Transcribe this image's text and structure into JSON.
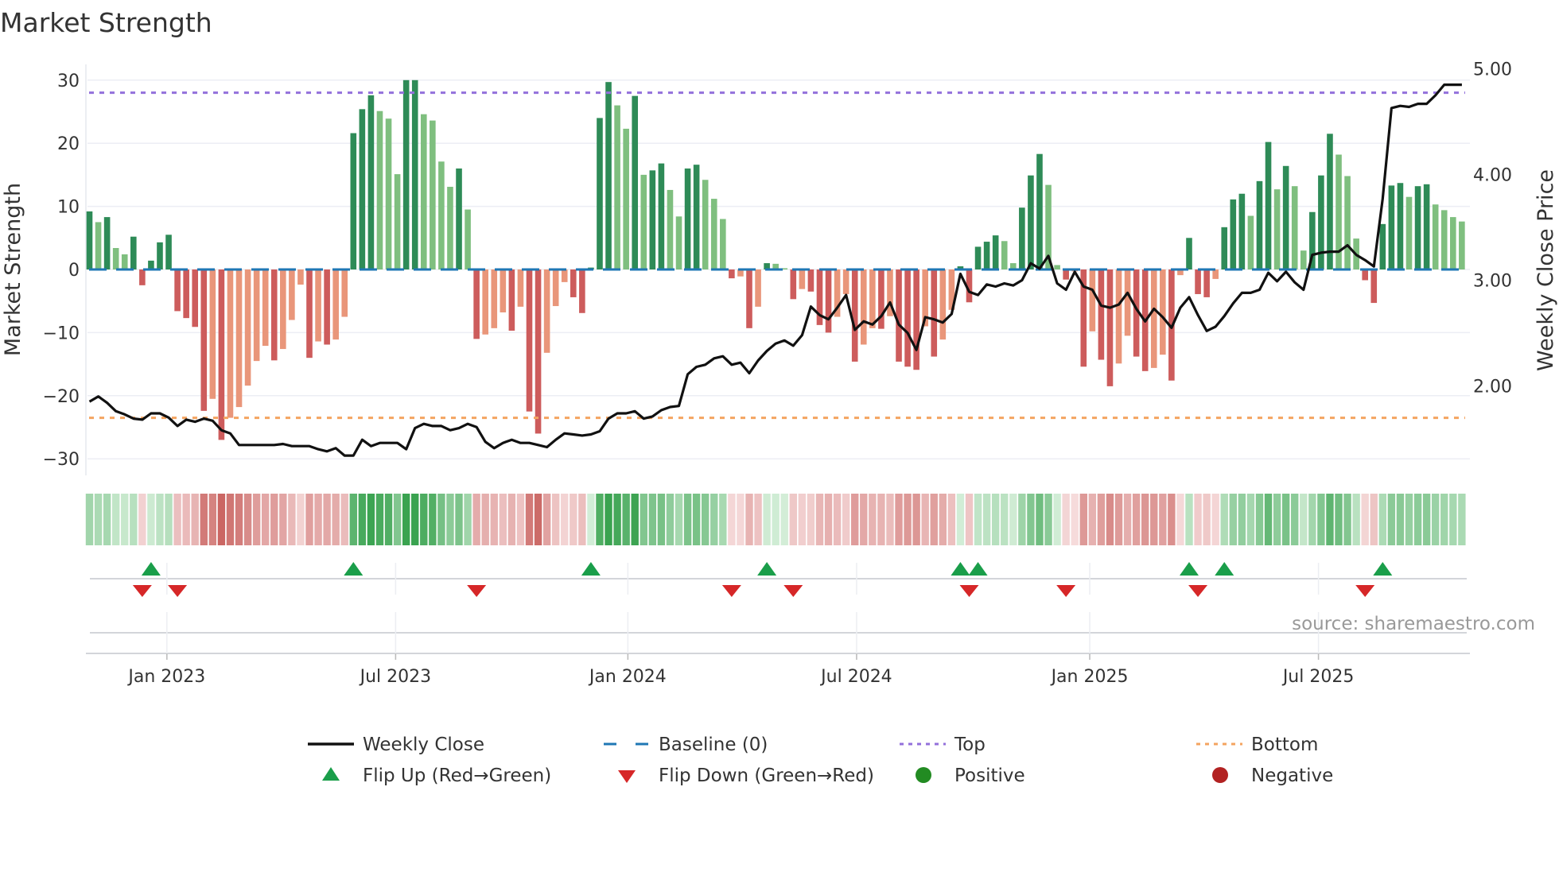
{
  "chart_data": {
    "type": "bar",
    "title": "Market Strength",
    "ylabel": "Market Strength",
    "y2label": "Weekly Close Price",
    "ylim": [
      -32.5,
      32.5
    ],
    "y2lim": [
      1.16,
      5.04
    ],
    "yticks": [
      30,
      20,
      10,
      0,
      -10,
      -20,
      -30
    ],
    "ytick_labels": [
      "30",
      "20",
      "10",
      "0",
      "−10",
      "−20",
      "−30"
    ],
    "y2ticks": [
      5,
      4,
      3,
      2
    ],
    "y2tick_labels": [
      "5.00",
      "4.00",
      "3.00",
      "2.00"
    ],
    "x_unit": "week index",
    "xticks": [
      8.8,
      34.8,
      61.2,
      87.2,
      113.7,
      139.7
    ],
    "xtick_labels": [
      "Jan 2023",
      "Jul 2023",
      "Jan 2024",
      "Jul 2024",
      "Jan 2025",
      "Jul 2025"
    ],
    "top_level": 28,
    "bottom_level": -23.5,
    "baseline": 0,
    "strength": [
      9.2,
      7.5,
      8.3,
      3.4,
      2.4,
      5.2,
      -2.5,
      1.4,
      4.3,
      5.5,
      -6.6,
      -7.7,
      -9.1,
      -22.4,
      -20.5,
      -27,
      -23.5,
      -21.8,
      -18.4,
      -14.5,
      -12.1,
      -14.4,
      -12.6,
      -8,
      -2.4,
      -14,
      -11.4,
      -11.9,
      -11.1,
      -7.5,
      21.6,
      25.4,
      27.6,
      25.1,
      23.9,
      15.1,
      30,
      30,
      24.6,
      23.6,
      17.1,
      13.1,
      16,
      9.5,
      -11,
      -10.3,
      -9.3,
      -6.8,
      -9.7,
      -5.9,
      -22.5,
      -26,
      -13.2,
      -5.8,
      -2,
      -4.4,
      -6.9,
      0.3,
      24,
      29.7,
      26,
      22.3,
      27.5,
      15,
      15.7,
      16.8,
      12.6,
      8.4,
      16,
      16.6,
      14.2,
      11.2,
      8,
      -1.4,
      -1.1,
      -9.3,
      -5.9,
      1,
      0.9,
      0.2,
      -4.7,
      -3.1,
      -3.5,
      -8.8,
      -10,
      -7.5,
      -3.9,
      -14.6,
      -11.9,
      -9.3,
      -9.4,
      -7.4,
      -14.6,
      -15.4,
      -15.9,
      -9,
      -13.8,
      -11.1,
      -6.4,
      0.5,
      -5.2,
      3.6,
      4.4,
      5.4,
      4.5,
      1,
      9.8,
      14.9,
      18.3,
      13.4,
      0.7,
      -1.6,
      -0.3,
      -15.4,
      -9.8,
      -14.3,
      -18.5,
      -14.9,
      -10.5,
      -13.8,
      -16.1,
      -15.6,
      -13.5,
      -17.6,
      -0.9,
      5,
      -3.9,
      -4.4,
      -1.5,
      6.7,
      11.1,
      12,
      8.5,
      14,
      20.2,
      12.7,
      16.4,
      13.2,
      3,
      9.1,
      14.9,
      21.5,
      18.2,
      14.8,
      4.9,
      -1.7,
      -5.3,
      7.2,
      13.3,
      13.7,
      11.5,
      13.2,
      13.5,
      10.3,
      9.4,
      8.3,
      7.6
    ],
    "weekly_close": [
      1.85,
      1.9,
      1.84,
      1.76,
      1.73,
      1.69,
      1.68,
      1.74,
      1.74,
      1.7,
      1.62,
      1.68,
      1.66,
      1.69,
      1.67,
      1.58,
      1.55,
      1.44,
      1.44,
      1.44,
      1.44,
      1.44,
      1.45,
      1.43,
      1.43,
      1.43,
      1.4,
      1.38,
      1.41,
      1.34,
      1.34,
      1.49,
      1.43,
      1.46,
      1.46,
      1.46,
      1.4,
      1.6,
      1.64,
      1.62,
      1.62,
      1.58,
      1.6,
      1.64,
      1.61,
      1.47,
      1.41,
      1.46,
      1.49,
      1.46,
      1.46,
      1.44,
      1.42,
      1.49,
      1.55,
      1.54,
      1.53,
      1.54,
      1.57,
      1.69,
      1.74,
      1.74,
      1.76,
      1.69,
      1.71,
      1.77,
      1.8,
      1.81,
      2.11,
      2.18,
      2.2,
      2.26,
      2.28,
      2.2,
      2.22,
      2.12,
      2.24,
      2.33,
      2.4,
      2.43,
      2.38,
      2.48,
      2.75,
      2.67,
      2.63,
      2.74,
      2.86,
      2.53,
      2.61,
      2.58,
      2.66,
      2.79,
      2.58,
      2.5,
      2.34,
      2.65,
      2.63,
      2.6,
      2.68,
      3.06,
      2.89,
      2.86,
      2.96,
      2.94,
      2.97,
      2.95,
      3.0,
      3.16,
      3.11,
      3.23,
      2.97,
      2.91,
      3.08,
      2.94,
      2.91,
      2.76,
      2.74,
      2.77,
      2.88,
      2.73,
      2.61,
      2.73,
      2.65,
      2.55,
      2.74,
      2.84,
      2.67,
      2.52,
      2.56,
      2.66,
      2.78,
      2.88,
      2.88,
      2.91,
      3.07,
      2.99,
      3.08,
      2.98,
      2.91,
      3.24,
      3.26,
      3.27,
      3.27,
      3.33,
      3.24,
      3.19,
      3.13,
      3.77,
      4.63,
      4.65,
      4.64,
      4.67,
      4.67,
      4.75,
      4.85,
      4.85,
      4.85
    ],
    "flip_up_weeks": [
      7,
      30,
      57,
      77,
      99,
      101,
      125,
      129,
      147
    ],
    "flip_down_weeks": [
      6,
      10,
      44,
      73,
      80,
      100,
      111,
      126,
      145
    ],
    "legend": {
      "placement": "bottom",
      "items": [
        {
          "label": "Weekly Close",
          "kind": "line"
        },
        {
          "label": "Baseline (0)",
          "kind": "dash"
        },
        {
          "label": "Top",
          "kind": "dot-top"
        },
        {
          "label": "Bottom",
          "kind": "dot-bottom"
        },
        {
          "label": "Flip Up (Red→Green)",
          "kind": "tri-up"
        },
        {
          "label": "Flip Down (Green→Red)",
          "kind": "tri-down"
        },
        {
          "label": "Positive",
          "kind": "circle-pos"
        },
        {
          "label": "Negative",
          "kind": "circle-neg"
        }
      ]
    },
    "source": "source: sharemaestro.com"
  },
  "colors": {
    "green_strong": "#2e8b57",
    "green_weak": "#7fbf7f",
    "red_strong": "#cd5c5c",
    "red_weak": "#e9967a",
    "top": "#9370db",
    "bottom": "#f4a460",
    "baseline": "#1f77b4",
    "flip_up": "#1a9e4a",
    "flip_down": "#d62728",
    "positive": "#228b22",
    "negative": "#b22222",
    "close": "#111111"
  }
}
